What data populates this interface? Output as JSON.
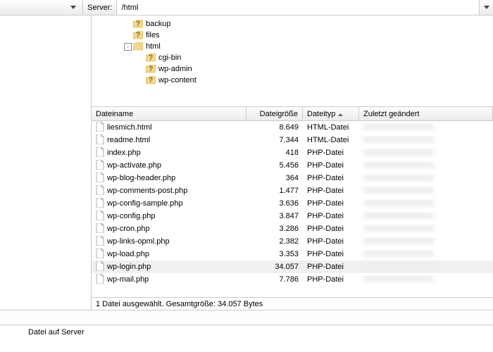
{
  "topbar": {
    "server_label": "Server:",
    "path_value": "/html"
  },
  "tree": {
    "items": [
      {
        "label": "backup",
        "icon": "question",
        "level": 1,
        "expander": ""
      },
      {
        "label": "files",
        "icon": "question",
        "level": 1,
        "expander": ""
      },
      {
        "label": "html",
        "icon": "folder",
        "level": 1,
        "expander": "-"
      },
      {
        "label": "cgi-bin",
        "icon": "question",
        "level": 2,
        "expander": ""
      },
      {
        "label": "wp-admin",
        "icon": "question",
        "level": 2,
        "expander": ""
      },
      {
        "label": "wp-content",
        "icon": "question",
        "level": 2,
        "expander": ""
      }
    ]
  },
  "grid": {
    "columns": {
      "name": "Dateiname",
      "size": "Dateigröße",
      "type": "Dateityp",
      "modified": "Zuletzt geändert"
    },
    "sort_column": "type",
    "rows": [
      {
        "name": "liesmich.html",
        "size": "8.649",
        "type": "HTML-Datei",
        "selected": false
      },
      {
        "name": "readme.html",
        "size": "7.344",
        "type": "HTML-Datei",
        "selected": false
      },
      {
        "name": "index.php",
        "size": "418",
        "type": "PHP-Datei",
        "selected": false
      },
      {
        "name": "wp-activate.php",
        "size": "5.456",
        "type": "PHP-Datei",
        "selected": false
      },
      {
        "name": "wp-blog-header.php",
        "size": "364",
        "type": "PHP-Datei",
        "selected": false
      },
      {
        "name": "wp-comments-post.php",
        "size": "1.477",
        "type": "PHP-Datei",
        "selected": false
      },
      {
        "name": "wp-config-sample.php",
        "size": "3.636",
        "type": "PHP-Datei",
        "selected": false
      },
      {
        "name": "wp-config.php",
        "size": "3.847",
        "type": "PHP-Datei",
        "selected": false
      },
      {
        "name": "wp-cron.php",
        "size": "3.286",
        "type": "PHP-Datei",
        "selected": false
      },
      {
        "name": "wp-links-opml.php",
        "size": "2.382",
        "type": "PHP-Datei",
        "selected": false
      },
      {
        "name": "wp-load.php",
        "size": "3.353",
        "type": "PHP-Datei",
        "selected": false
      },
      {
        "name": "wp-login.php",
        "size": "34.057",
        "type": "PHP-Datei",
        "selected": true
      },
      {
        "name": "wp-mail.php",
        "size": "7.786",
        "type": "PHP-Datei",
        "selected": false
      }
    ]
  },
  "status": {
    "text": "1 Datei ausgewählt. Gesamtgröße: 34.057 Bytes"
  },
  "footer": {
    "label": "Datei auf Server"
  }
}
